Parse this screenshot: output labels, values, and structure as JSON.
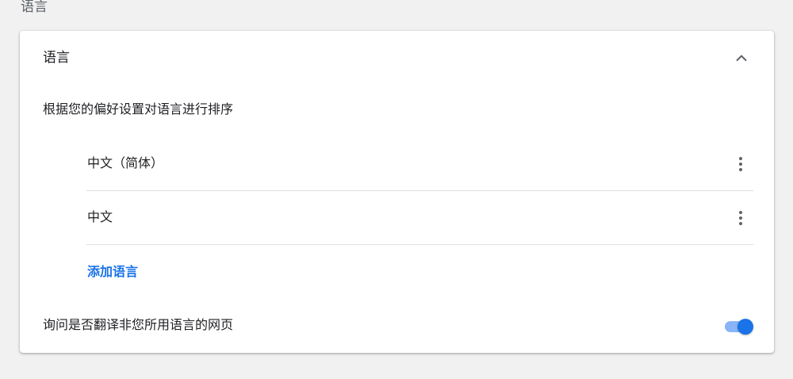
{
  "page": {
    "section_title": "语言"
  },
  "card": {
    "header_label": "语言",
    "collapse_icon": "chevron-up-icon",
    "description": "根据您的偏好设置对语言进行排序",
    "languages": [
      {
        "label": "中文（简体）",
        "menu_icon": "more-vert-icon"
      },
      {
        "label": "中文",
        "menu_icon": "more-vert-icon"
      }
    ],
    "add_language_label": "添加语言",
    "translate_prompt_label": "询问是否翻译非您所用语言的网页",
    "translate_prompt_enabled": true
  },
  "colors": {
    "accent": "#1a73e8",
    "toggle_track": "#8ab4f8",
    "background": "#f1f1f1",
    "card": "#ffffff"
  }
}
